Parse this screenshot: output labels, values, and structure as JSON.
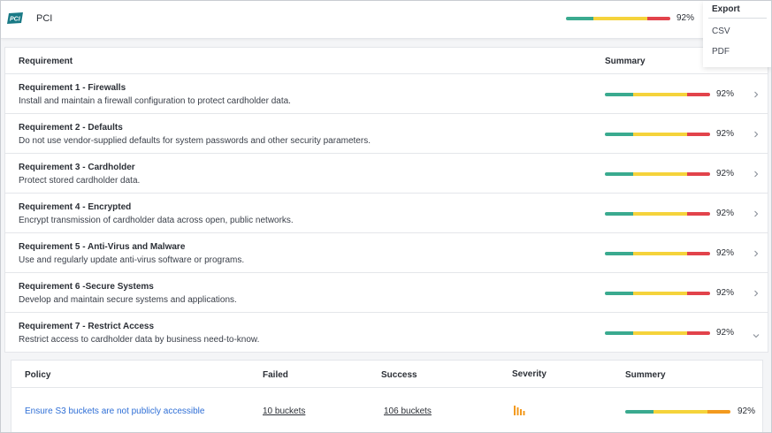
{
  "app": {
    "logo_text": "PCI",
    "title": "PCI",
    "overall_percent_label": "92%",
    "overall_percent": 92
  },
  "export_menu": {
    "title": "Export",
    "items": [
      "CSV",
      "PDF"
    ]
  },
  "colors": {
    "green": "#3aaa8f",
    "yellow": "#f5d33b",
    "red": "#e2434b",
    "orange": "#f39a1e",
    "link": "#2f6fd6",
    "severity": "#f39a1e"
  },
  "requirements_table": {
    "headers": {
      "requirement": "Requirement",
      "summary": "Summary"
    },
    "rows": [
      {
        "title": "Requirement 1 - Firewalls",
        "description": "Install and maintain a firewall configuration to protect cardholder data.",
        "percent_label": "92%",
        "percent": 92,
        "expanded": false
      },
      {
        "title": "Requirement 2 - Defaults",
        "description": "Do not use vendor-supplied defaults for system passwords and other security parameters.",
        "percent_label": "92%",
        "percent": 92,
        "expanded": false
      },
      {
        "title": "Requirement 3 - Cardholder",
        "description": "Protect stored cardholder data.",
        "percent_label": "92%",
        "percent": 92,
        "expanded": false
      },
      {
        "title": "Requirement 4 - Encrypted",
        "description": "Encrypt transmission of cardholder data across open, public networks.",
        "percent_label": "92%",
        "percent": 92,
        "expanded": false
      },
      {
        "title": "Requirement 5 - Anti-Virus and Malware",
        "description": "Use and regularly update anti-virus software or programs.",
        "percent_label": "92%",
        "percent": 92,
        "expanded": false
      },
      {
        "title": "Requirement 6 -Secure Systems",
        "description": "Develop and maintain secure systems and applications.",
        "percent_label": "92%",
        "percent": 92,
        "expanded": false
      },
      {
        "title": "Requirement 7 - Restrict Access",
        "description": "Restrict access to cardholder data by business need-to-know.",
        "percent_label": "92%",
        "percent": 92,
        "expanded": true
      }
    ]
  },
  "policy_table": {
    "headers": {
      "policy": "Policy",
      "failed": "Failed",
      "success": "Success",
      "severity": "Severity",
      "summary": "Summery"
    },
    "rows": [
      {
        "policy": "Ensure S3 buckets are not publicly accessible",
        "failed": "10 buckets",
        "success": "106 buckets",
        "severity_icon": "severity-bars-icon",
        "percent_label": "92%",
        "percent": 92
      }
    ]
  }
}
